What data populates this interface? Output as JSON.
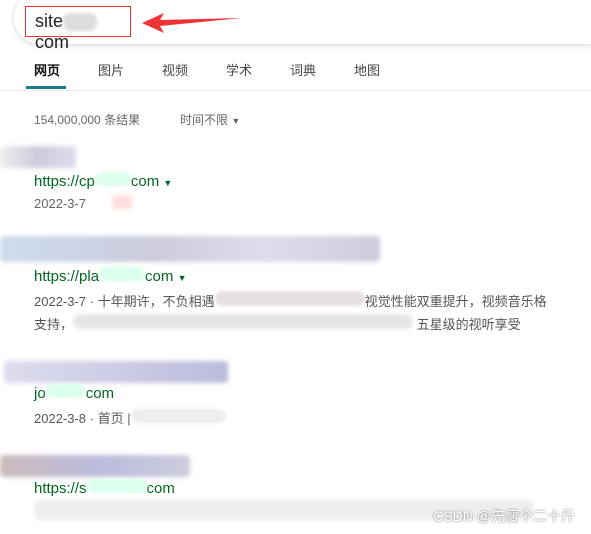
{
  "search": {
    "query_prefix": "site",
    "query_suffix": "com"
  },
  "tabs": [
    {
      "label": "网页",
      "active": true
    },
    {
      "label": "图片"
    },
    {
      "label": "视频"
    },
    {
      "label": "学术"
    },
    {
      "label": "词典"
    },
    {
      "label": "地图"
    }
  ],
  "results_count": "154,000,000 条结果",
  "time_filter": "时间不限",
  "results": [
    {
      "url_prefix": "https://cp",
      "url_suffix": "com",
      "date": "2022-3-7"
    },
    {
      "url_prefix": "https://pla",
      "url_suffix": "com",
      "date": "2022-3-7",
      "snippet_a": "十年期许，不负相遇",
      "snippet_b": "视觉性能双重提升，视频音乐格",
      "snippet_c": "支持，",
      "snippet_d": "五星级的视听享受"
    },
    {
      "url_prefix": "jo",
      "url_suffix": "com",
      "date": "2022-3-8",
      "snippet_a": "首页 |"
    },
    {
      "url_prefix": "https://s",
      "url_suffix": "com"
    }
  ],
  "watermark": "CSDN @先瘦个二十斤",
  "colors": {
    "accent": "#1a7c8c",
    "url": "#00671f",
    "highlight": "#e33333"
  }
}
